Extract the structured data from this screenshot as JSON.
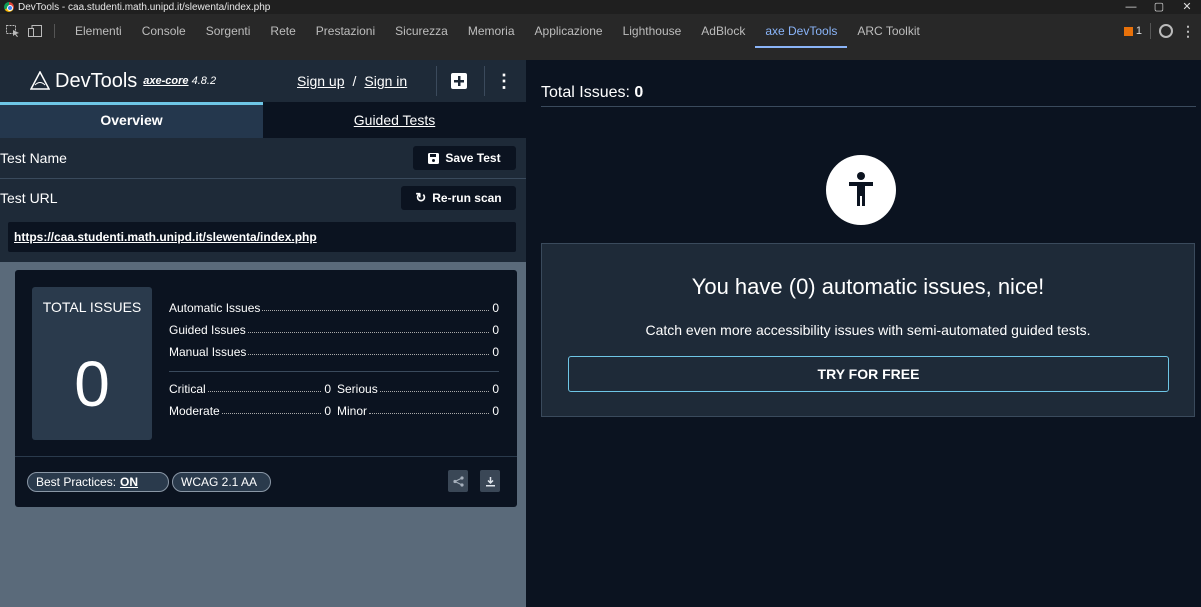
{
  "window": {
    "title": "DevTools - caa.studenti.math.unipd.it/slewenta/index.php",
    "controls": [
      "—",
      "▢",
      "✕"
    ]
  },
  "devtools_tabs": [
    {
      "label": "Elementi"
    },
    {
      "label": "Console"
    },
    {
      "label": "Sorgenti"
    },
    {
      "label": "Rete"
    },
    {
      "label": "Prestazioni"
    },
    {
      "label": "Sicurezza"
    },
    {
      "label": "Memoria"
    },
    {
      "label": "Applicazione"
    },
    {
      "label": "Lighthouse"
    },
    {
      "label": "AdBlock"
    },
    {
      "label": "axe DevTools",
      "active": true
    },
    {
      "label": "ARC Toolkit"
    }
  ],
  "issues_badge": "1",
  "axe": {
    "brand": "DevTools",
    "core_label": "axe-core",
    "core_version": "4.8.2",
    "sign_up": "Sign up",
    "slash": "/",
    "sign_in": "Sign in",
    "tabs": {
      "overview": "Overview",
      "guided": "Guided Tests"
    },
    "test_name_label": "Test Name",
    "save_test": "Save Test",
    "test_url_label": "Test URL",
    "rerun_scan": "Re-run scan",
    "test_url": "https://caa.studenti.math.unipd.it/slewenta/index.php"
  },
  "summary": {
    "total_label": "TOTAL ISSUES",
    "total_value": "0",
    "automatic_label": "Automatic Issues",
    "automatic_value": "0",
    "guided_label": "Guided Issues",
    "guided_value": "0",
    "manual_label": "Manual Issues",
    "manual_value": "0",
    "critical_label": "Critical",
    "critical_value": "0",
    "serious_label": "Serious",
    "serious_value": "0",
    "moderate_label": "Moderate",
    "moderate_value": "0",
    "minor_label": "Minor",
    "minor_value": "0",
    "best_practices_label": "Best Practices:",
    "best_practices_value": "ON",
    "wcag_label": "WCAG 2.1 AA"
  },
  "right": {
    "total_issues_label": "Total Issues:",
    "total_issues_value": "0",
    "heading": "You have (0) automatic issues, nice!",
    "subtext": "Catch even more accessibility issues with semi-automated guided tests.",
    "cta": "TRY FOR FREE"
  },
  "colors": {
    "accent": "#6ec6e6",
    "panel": "#1e2a38",
    "background": "#0b1320",
    "active_tab": "#8ab4f8"
  }
}
